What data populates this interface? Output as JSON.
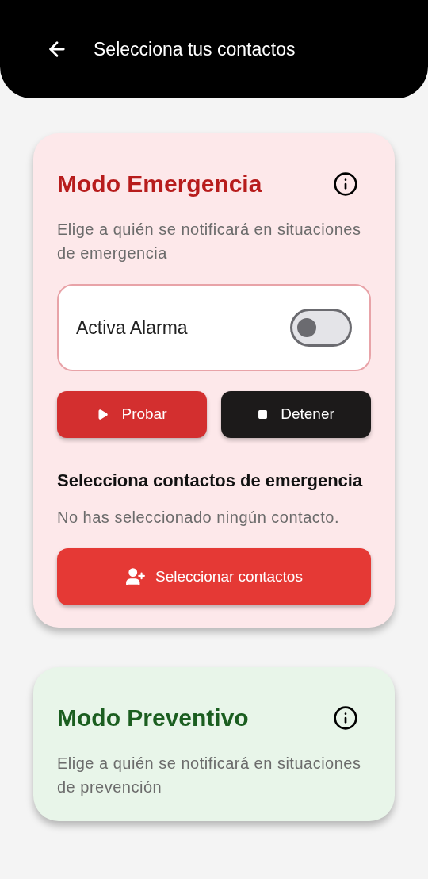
{
  "header": {
    "title": "Selecciona tus contactos"
  },
  "modes": [
    {
      "kind": "emergency",
      "title": "Modo Emergencia",
      "description": "Elige a quién se notificará en situaciones de emergencia",
      "alarm": {
        "label": "Activa Alarma",
        "on": false
      },
      "buttons": [
        {
          "kind": "play",
          "label": "Probar"
        },
        {
          "kind": "stop",
          "label": "Detener"
        }
      ],
      "contacts_heading": "Selecciona contactos de emergencia",
      "empty_message": "No has seleccionado ningún contacto.",
      "select_button": "Seleccionar contactos"
    },
    {
      "kind": "preventive",
      "title": "Modo Preventivo",
      "description": "Elige a quién se notificará en situaciones de prevención"
    }
  ]
}
